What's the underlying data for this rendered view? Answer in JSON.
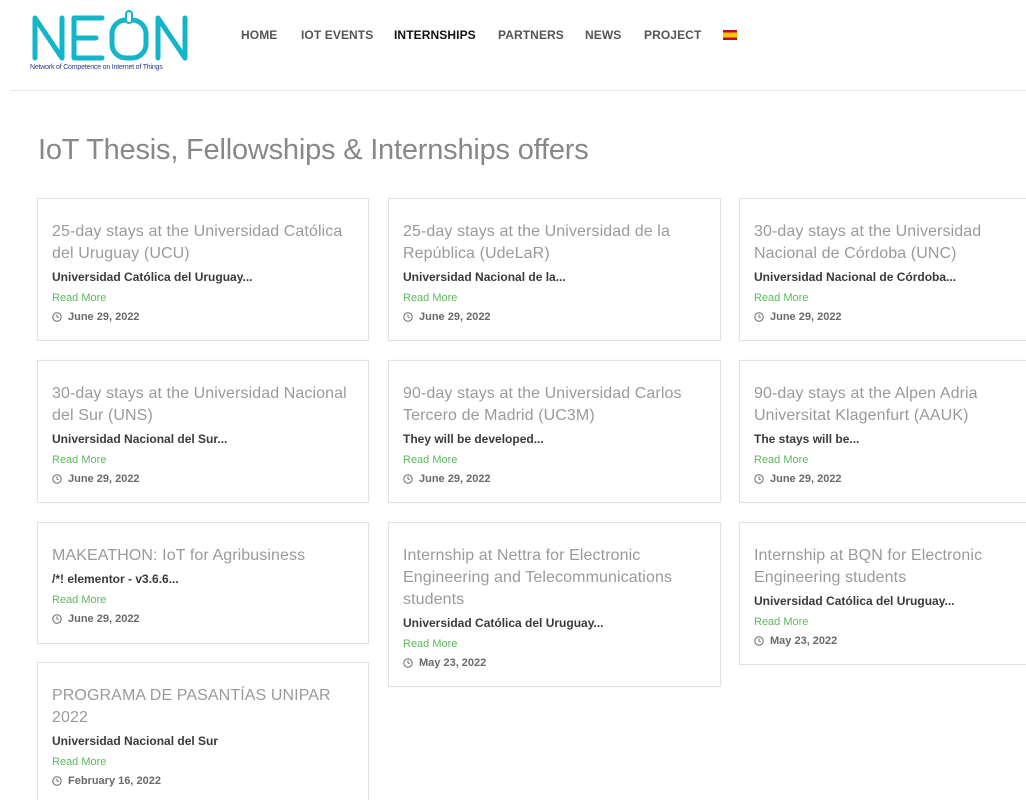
{
  "logo": {
    "wordmark": "NEON",
    "tagline": "Network of Competence on Internet of Things"
  },
  "nav": {
    "items": [
      {
        "label": "HOME"
      },
      {
        "label": "IOT EVENTS"
      },
      {
        "label": "INTERNSHIPS"
      },
      {
        "label": "PARTNERS"
      },
      {
        "label": "NEWS"
      },
      {
        "label": "PROJECT"
      }
    ],
    "active": "INTERNSHIPS"
  },
  "page": {
    "title": "IoT Thesis, Fellowships & Internships offers"
  },
  "cards": [
    {
      "title": "25-day stays at the Universidad Católica del Uruguay (UCU)",
      "excerpt": "Universidad Católica del Uruguay...",
      "read_more": "Read More",
      "date": "June 29, 2022"
    },
    {
      "title": "25-day stays at the Universidad de la República (UdeLaR)",
      "excerpt": "Universidad Nacional de la...",
      "read_more": "Read More",
      "date": "June 29, 2022"
    },
    {
      "title": "30-day stays at the Universidad Nacional de Córdoba (UNC)",
      "excerpt": "Universidad Nacional de Córdoba...",
      "read_more": "Read More",
      "date": "June 29, 2022"
    },
    {
      "title": "30-day stays at the Universidad Nacional del Sur (UNS)",
      "excerpt": "Universidad Nacional del Sur...",
      "read_more": "Read More",
      "date": "June 29, 2022"
    },
    {
      "title": "90-day stays at the Universidad Carlos Tercero de Madrid (UC3M)",
      "excerpt": "They will be developed...",
      "read_more": "Read More",
      "date": "June 29, 2022"
    },
    {
      "title": "90-day stays at the Alpen Adria Universitat Klagenfurt (AAUK)",
      "excerpt": "The stays will be...",
      "read_more": "Read More",
      "date": "June 29, 2022"
    },
    {
      "title": "MAKEATHON: IoT for Agribusiness",
      "excerpt": "/*! elementor - v3.6.6...",
      "read_more": "Read More",
      "date": "June 29, 2022"
    },
    {
      "title": "Internship at Nettra for Electronic Engineering and Telecommunications students",
      "excerpt": "Universidad Católica del Uruguay...",
      "read_more": "Read More",
      "date": "May 23, 2022"
    },
    {
      "title": "Internship at BQN for Electronic Engineering students",
      "excerpt": "Universidad Católica del Uruguay...",
      "read_more": "Read More",
      "date": "May 23, 2022"
    },
    {
      "title": "PROGRAMA DE PASANTÍAS UNIPAR 2022",
      "excerpt": "Universidad Nacional del Sur",
      "read_more": "Read More",
      "date": "February 16, 2022"
    }
  ],
  "colors": {
    "logo": "#12b5c9",
    "read_more": "#5cb85c",
    "tagline": "#2a3a8c"
  },
  "icons": {
    "date": "clock-icon",
    "language": "spanish-flag-icon"
  }
}
